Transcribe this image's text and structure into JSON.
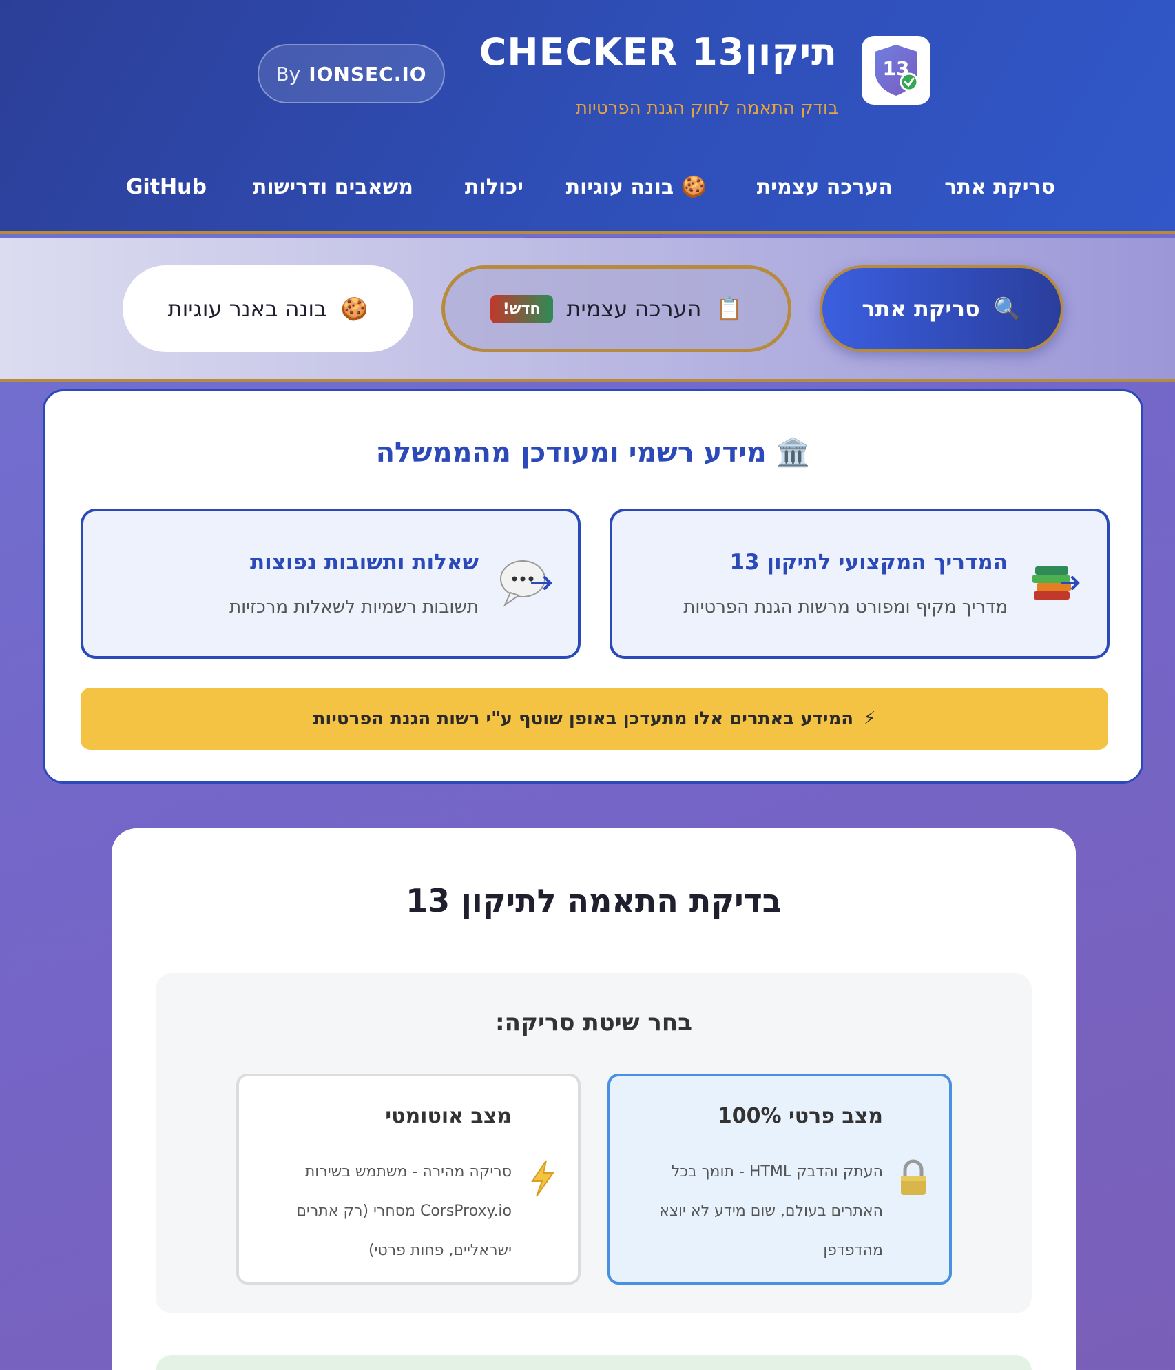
{
  "header": {
    "badge_number": "13",
    "title": "תיקון13 CHECKER",
    "subtitle": "בודק התאמה לחוק הגנת הפרטיות",
    "by_label": "By",
    "by_org": "IONSEC.IO"
  },
  "nav": {
    "items": [
      {
        "label": "סריקת אתר"
      },
      {
        "label": "הערכה עצמית"
      },
      {
        "label": "🍪 בונה עוגיות"
      },
      {
        "label": "יכולות"
      },
      {
        "label": "משאבים ודרישות"
      },
      {
        "label": "GitHub"
      }
    ]
  },
  "modes": {
    "scan": {
      "label": "סריקת אתר",
      "icon": "🔍"
    },
    "self": {
      "label": "הערכה עצמית",
      "icon": "📋",
      "badge": "חדש!"
    },
    "cookie": {
      "label": "בונה באנר עוגיות",
      "icon": "🍪"
    }
  },
  "gov": {
    "icon": "🏛️",
    "title": "מידע רשמי ומעודכן מהממשלה",
    "cards": [
      {
        "title": "המדריך המקצועי לתיקון 13",
        "desc": "מדריך מקיף ומפורט מרשות הגנת הפרטיות",
        "icon": "books-icon"
      },
      {
        "title": "שאלות ותשובות נפוצות",
        "desc": "תשובות רשמיות לשאלות מרכזיות",
        "icon": "speech-bubble-icon"
      }
    ],
    "banner_icon": "⚡",
    "banner": "המידע באתרים אלו מתעדכן באופן שוטף ע\"י רשות הגנת הפרטיות"
  },
  "compliance": {
    "title": "בדיקת התאמה לתיקון 13",
    "method_label": "בחר שיטת סריקה:",
    "options": [
      {
        "title": "מצב פרטי 100%",
        "desc": "העתק והדבק HTML - תומך בכל האתרים בעולם, שום מידע לא יוצא מהדפדפן",
        "icon": "🔒",
        "selected": true
      },
      {
        "title": "מצב אוטומטי",
        "desc": "סריקה מהירה - משתמש בשירות CorsProxy.io מסחרי (רק אתרים ישראליים, פחות פרטי)",
        "icon": "⚡",
        "selected": false
      }
    ]
  },
  "colors": {
    "primary": "#2b49b8",
    "gold": "#b68b3e",
    "banner_yellow": "#f5c344",
    "selected_blue": "#4a90e2"
  }
}
